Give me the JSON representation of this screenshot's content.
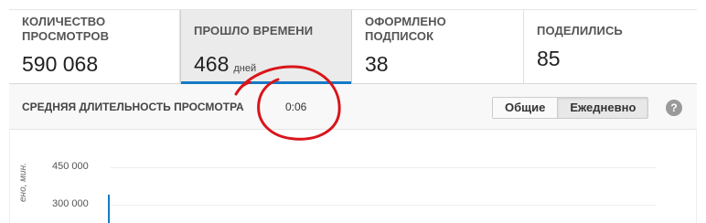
{
  "stats": [
    {
      "label": "Количество просмотров",
      "value": "590 068",
      "unit": ""
    },
    {
      "label": "Прошло времени",
      "value": "468",
      "unit": "дней",
      "active": true
    },
    {
      "label": "Оформлено подписок",
      "value": "38",
      "unit": ""
    },
    {
      "label": "Поделились",
      "value": "85",
      "unit": ""
    }
  ],
  "avg_duration": {
    "label": "Средняя длительность просмотра",
    "value": "0:06"
  },
  "toggle": {
    "options": [
      "Общие",
      "Ежедневно"
    ],
    "selected": "Ежедневно"
  },
  "help_icon": "?",
  "chart": {
    "y_axis_label": "ено, мин.",
    "ticks": [
      "450 000",
      "300 000"
    ]
  },
  "colors": {
    "accent": "#167ac6",
    "annotation": "#d9151b"
  },
  "icons": {
    "help": "question-circle-icon"
  }
}
